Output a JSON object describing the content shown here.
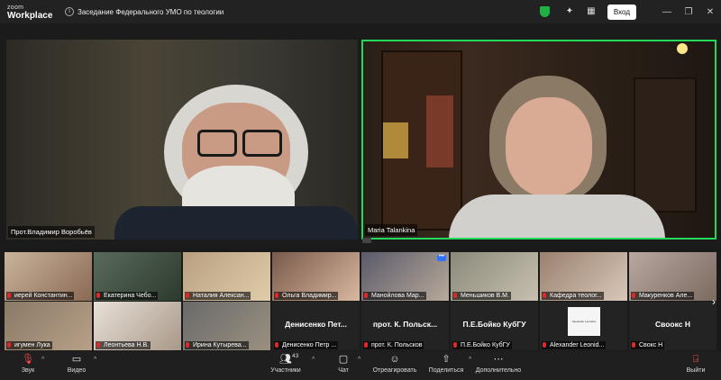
{
  "app": {
    "logo_line1": "zoom",
    "logo_line2": "Workplace",
    "meeting_title": "Заседание Федерального УМО по теологии",
    "signin_label": "Вход",
    "colors": {
      "active_speaker_border": "#23d959",
      "shield": "#1fb141",
      "muted": "#e02828"
    }
  },
  "speakers": [
    {
      "name": "Прот.Владимир Воробьёв"
    },
    {
      "name": "Maria Talankina"
    }
  ],
  "gallery": {
    "row1": [
      {
        "name": "иерей Константин..."
      },
      {
        "name": "Екатерина Чебо..."
      },
      {
        "name": "Наталия Алексан..."
      },
      {
        "name": "Ольга Владимир..."
      },
      {
        "name": "Манойлова Мар..."
      },
      {
        "name": "Меньшиков В.М."
      },
      {
        "name": "Кафедра теолог..."
      },
      {
        "name": "Макуренков Але..."
      }
    ],
    "row2": [
      {
        "name": "игумен Лука",
        "display": ""
      },
      {
        "name": "Леонтьева Н.В.",
        "display": ""
      },
      {
        "name": "Ирина Кутырева...",
        "display": ""
      },
      {
        "name": "Денисенко Петр ...",
        "display": "Денисенко   Пет..."
      },
      {
        "name": "прот. К. Польсков",
        "display": "прот. К. Польск..."
      },
      {
        "name": "П.Е.Бойко КубГУ",
        "display": "П.Е.Бойко КубГУ"
      },
      {
        "name": "Alexander Leonid...",
        "display": ""
      },
      {
        "name": "Свокс Н",
        "display": "Своокс Н"
      }
    ],
    "whitecard_text": "Alexander Leonidov",
    "more_icon": "•••",
    "next_icon": "›"
  },
  "toolbar": {
    "audio": "Звук",
    "video": "Видео",
    "participants": "Участники",
    "participants_count": "43",
    "chat": "Чат",
    "react": "Отреагировать",
    "share": "Поделиться",
    "more": "Дополнительно",
    "leave": "Выйти"
  }
}
